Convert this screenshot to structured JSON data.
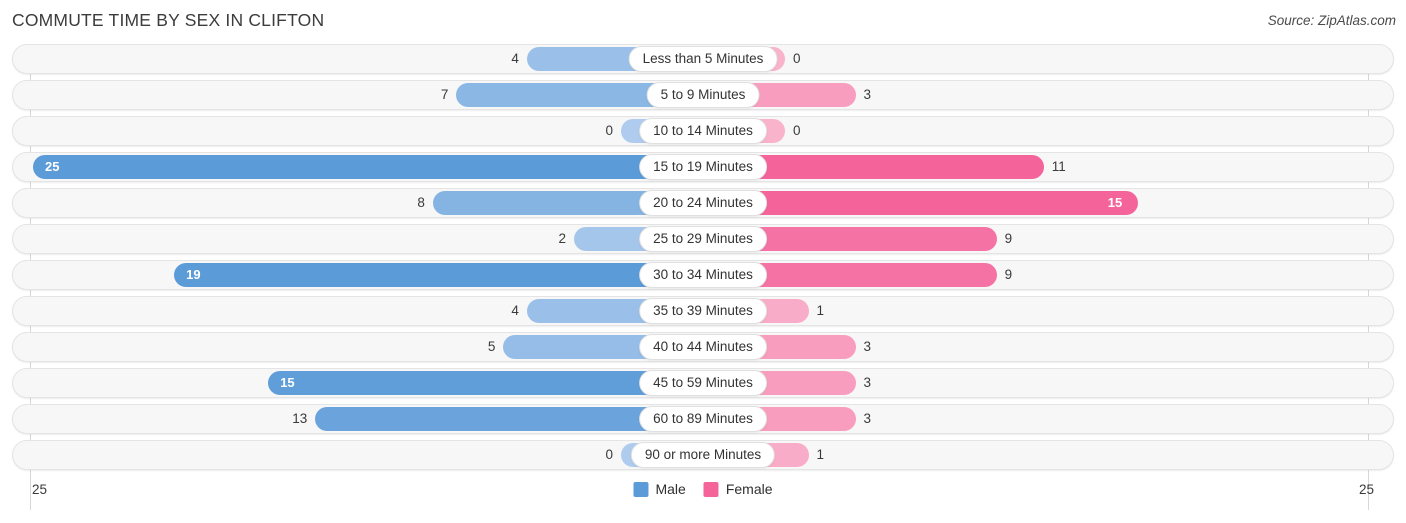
{
  "header": {
    "title": "COMMUTE TIME BY SEX IN CLIFTON",
    "source": "Source: ZipAtlas.com"
  },
  "legend": {
    "male_label": "Male",
    "female_label": "Female",
    "male_color": "#5b9bd8",
    "female_color": "#f4649b"
  },
  "axis": {
    "left_label": "25",
    "right_label": "25"
  },
  "chart_data": {
    "type": "bar",
    "orientation": "horizontal-diverging",
    "title": "COMMUTE TIME BY SEX IN CLIFTON",
    "xlabel": "",
    "ylabel": "",
    "xlim": [
      25,
      25
    ],
    "grid": true,
    "legend_position": "bottom-center",
    "categories": [
      "Less than 5 Minutes",
      "5 to 9 Minutes",
      "10 to 14 Minutes",
      "15 to 19 Minutes",
      "20 to 24 Minutes",
      "25 to 29 Minutes",
      "30 to 34 Minutes",
      "35 to 39 Minutes",
      "40 to 44 Minutes",
      "45 to 59 Minutes",
      "60 to 89 Minutes",
      "90 or more Minutes"
    ],
    "series": [
      {
        "name": "Male",
        "values": [
          4,
          7,
          0,
          25,
          8,
          2,
          19,
          4,
          5,
          15,
          13,
          0
        ]
      },
      {
        "name": "Female",
        "values": [
          0,
          3,
          0,
          11,
          15,
          9,
          9,
          1,
          3,
          3,
          3,
          1
        ]
      }
    ]
  },
  "rows": [
    {
      "category": "Less than 5 Minutes",
      "male": "4",
      "female": "0"
    },
    {
      "category": "5 to 9 Minutes",
      "male": "7",
      "female": "3"
    },
    {
      "category": "10 to 14 Minutes",
      "male": "0",
      "female": "0"
    },
    {
      "category": "15 to 19 Minutes",
      "male": "25",
      "female": "11"
    },
    {
      "category": "20 to 24 Minutes",
      "male": "8",
      "female": "15"
    },
    {
      "category": "25 to 29 Minutes",
      "male": "2",
      "female": "9"
    },
    {
      "category": "30 to 34 Minutes",
      "male": "19",
      "female": "9"
    },
    {
      "category": "35 to 39 Minutes",
      "male": "4",
      "female": "1"
    },
    {
      "category": "40 to 44 Minutes",
      "male": "5",
      "female": "3"
    },
    {
      "category": "45 to 59 Minutes",
      "male": "15",
      "female": "3"
    },
    {
      "category": "60 to 89 Minutes",
      "male": "13",
      "female": "3"
    },
    {
      "category": "90 or more Minutes",
      "male": "0",
      "female": "1"
    }
  ]
}
